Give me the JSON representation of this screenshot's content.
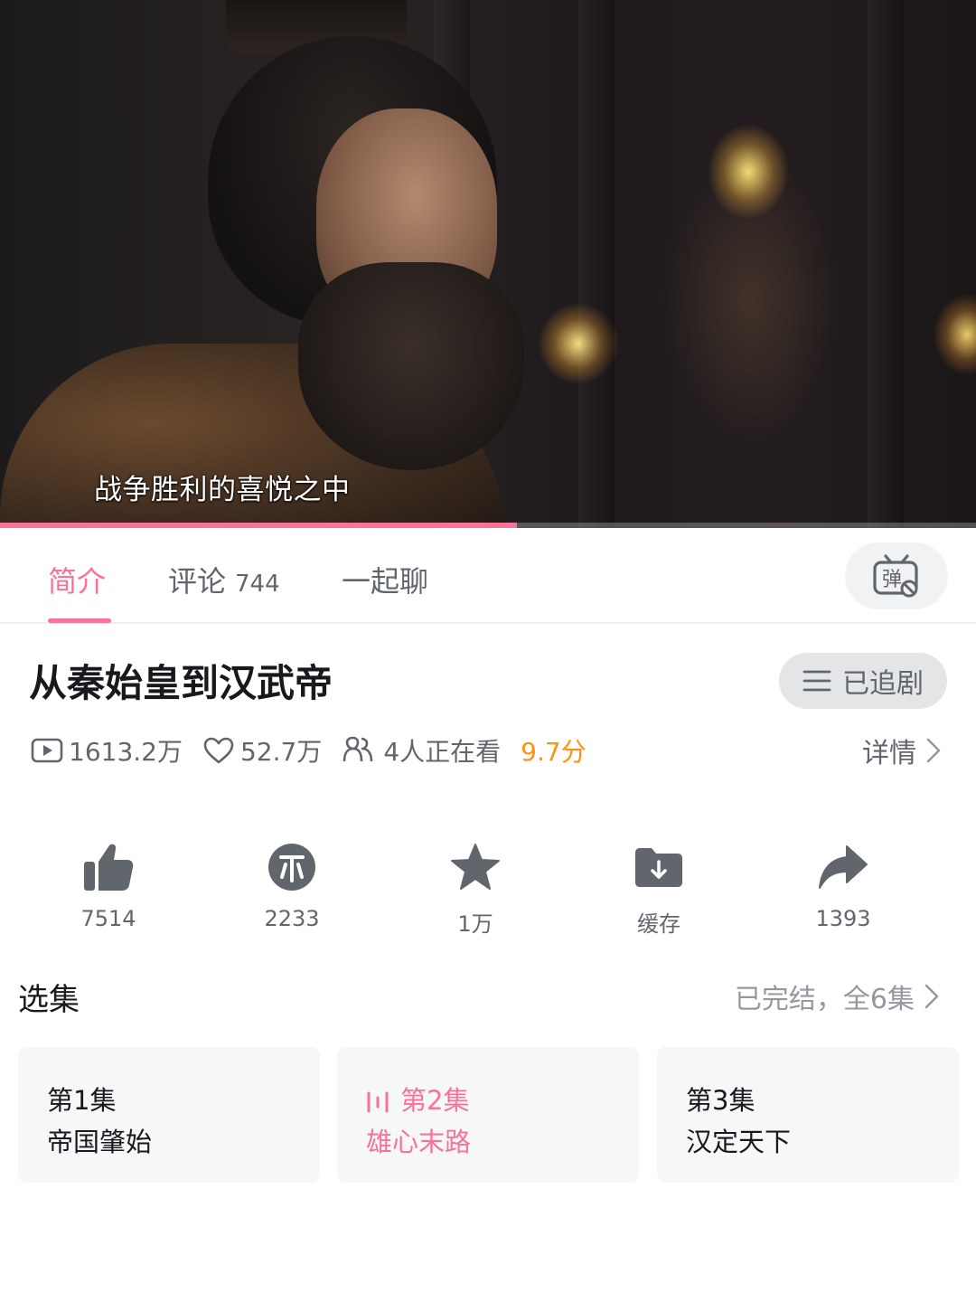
{
  "player": {
    "subtitle": "战争胜利的喜悦之中",
    "progress_percent": 53
  },
  "tabs": {
    "intro": "简介",
    "comments": "评论",
    "comments_count": "744",
    "chat": "一起聊"
  },
  "video": {
    "title": "从秦始皇到汉武帝",
    "follow_label": "已追剧",
    "plays": "1613.2万",
    "likes_stat": "52.7万",
    "watching": "4人正在看",
    "score": "9.7分",
    "detail_label": "详情"
  },
  "actions": [
    {
      "icon": "thumbs-up-icon",
      "label": "7514"
    },
    {
      "icon": "coin-icon",
      "label": "2233"
    },
    {
      "icon": "star-icon",
      "label": "1万"
    },
    {
      "icon": "download-icon",
      "label": "缓存"
    },
    {
      "icon": "share-icon",
      "label": "1393"
    }
  ],
  "episodes": {
    "header": "选集",
    "status": "已完结，全6集",
    "items": [
      {
        "number": "第1集",
        "name": "帝国肇始",
        "active": false
      },
      {
        "number": "第2集",
        "name": "雄心末路",
        "active": true
      },
      {
        "number": "第3集",
        "name": "汉定天下",
        "active": false
      }
    ]
  },
  "colors": {
    "accent": "#fb7299",
    "score": "#ff9212",
    "text_secondary": "#61666d"
  }
}
